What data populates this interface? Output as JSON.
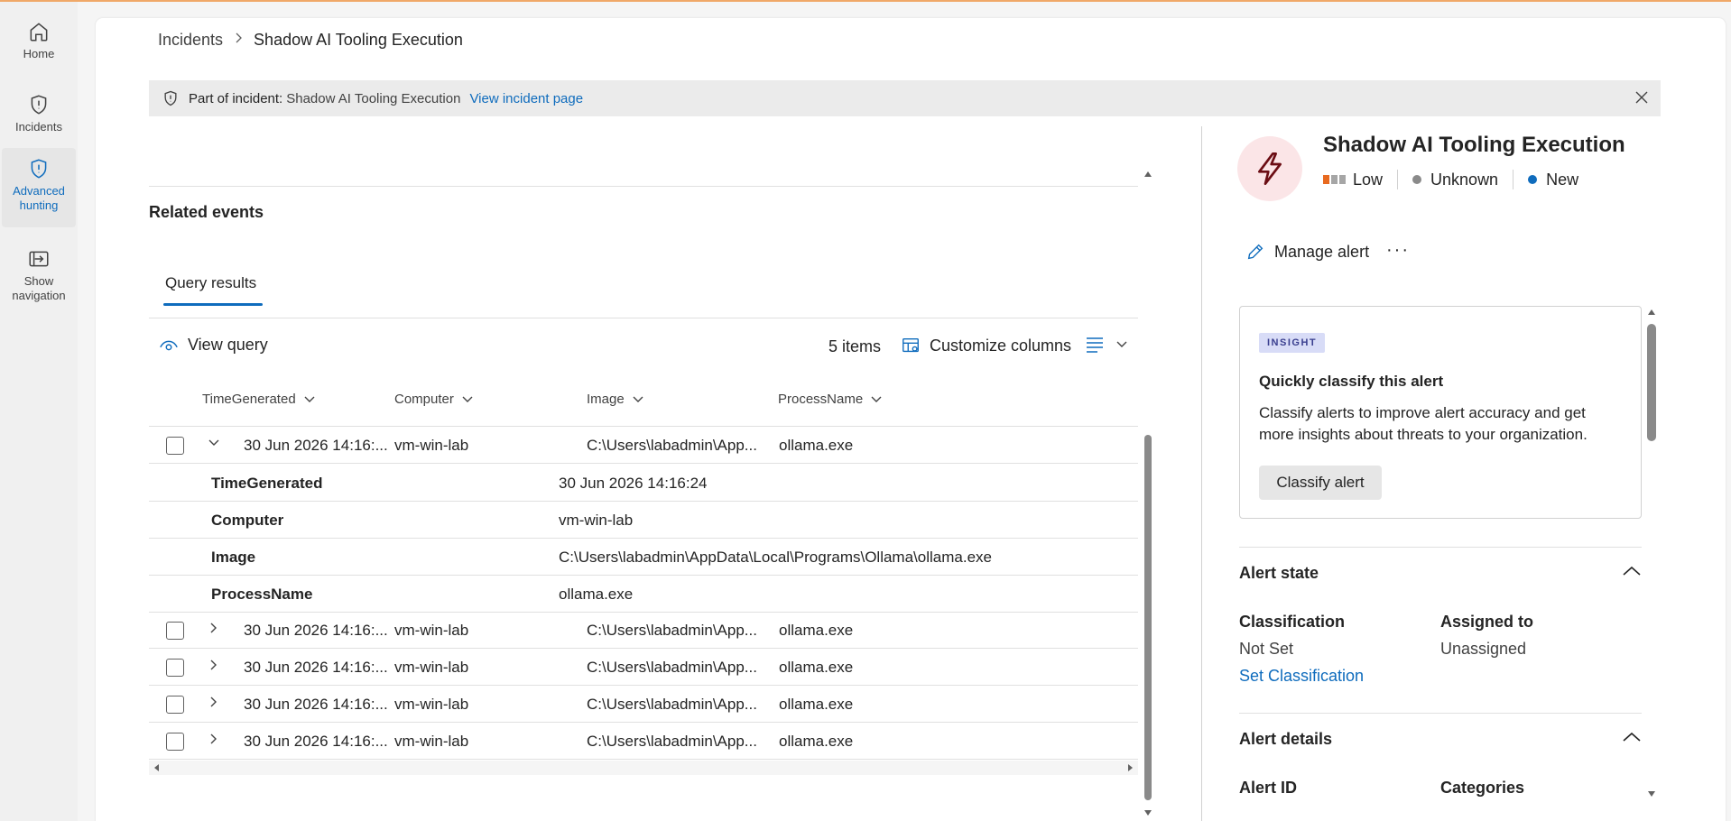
{
  "nav": {
    "home": "Home",
    "incidents": "Incidents",
    "advanced_hunting_1": "Advanced",
    "advanced_hunting_2": "hunting",
    "show_nav_1": "Show",
    "show_nav_2": "navigation"
  },
  "breadcrumb": {
    "root": "Incidents",
    "current": "Shadow AI Tooling Execution"
  },
  "banner": {
    "label": "Part of incident:",
    "value": "Shadow AI Tooling Execution",
    "link": "View incident page"
  },
  "related": {
    "title": "Related events",
    "tab": "Query results",
    "view_query": "View query",
    "items_count": "5 items",
    "customize_columns": "Customize columns"
  },
  "table": {
    "columns": [
      "TimeGenerated",
      "Computer",
      "Image",
      "ProcessName"
    ],
    "rows": [
      {
        "time": "30 Jun 2026 14:16:...",
        "computer": "vm-win-lab",
        "image": "C:\\Users\\labadmin\\App...",
        "process": "ollama.exe"
      },
      {
        "time": "30 Jun 2026 14:16:...",
        "computer": "vm-win-lab",
        "image": "C:\\Users\\labadmin\\App...",
        "process": "ollama.exe"
      },
      {
        "time": "30 Jun 2026 14:16:...",
        "computer": "vm-win-lab",
        "image": "C:\\Users\\labadmin\\App...",
        "process": "ollama.exe"
      },
      {
        "time": "30 Jun 2026 14:16:...",
        "computer": "vm-win-lab",
        "image": "C:\\Users\\labadmin\\App...",
        "process": "ollama.exe"
      },
      {
        "time": "30 Jun 2026 14:16:...",
        "computer": "vm-win-lab",
        "image": "C:\\Users\\labadmin\\App...",
        "process": "ollama.exe"
      }
    ],
    "details": [
      {
        "key": "TimeGenerated",
        "value": "30 Jun 2026 14:16:24"
      },
      {
        "key": "Computer",
        "value": "vm-win-lab"
      },
      {
        "key": "Image",
        "value": "C:\\Users\\labadmin\\AppData\\Local\\Programs\\Ollama\\ollama.exe"
      },
      {
        "key": "ProcessName",
        "value": "ollama.exe"
      }
    ]
  },
  "alert": {
    "title": "Shadow AI Tooling Execution",
    "severity": "Low",
    "determination": "Unknown",
    "status": "New",
    "manage": "Manage alert",
    "more": "···"
  },
  "insight": {
    "badge": "INSIGHT",
    "heading": "Quickly classify this alert",
    "body": "Classify alerts to improve alert accuracy and get more insights about threats to your organization.",
    "button": "Classify alert"
  },
  "alert_state": {
    "title": "Alert state",
    "classification_label": "Classification",
    "classification_value": "Not Set",
    "set_classification": "Set Classification",
    "assigned_label": "Assigned to",
    "assigned_value": "Unassigned"
  },
  "alert_details": {
    "title": "Alert details",
    "alert_id_label": "Alert ID",
    "categories_label": "Categories"
  },
  "colors": {
    "accent": "#0f6cbd",
    "severity_low": "#e86a20",
    "status_new": "#0f6cbd",
    "unknown_dot": "#8a8a8a",
    "alert_icon": "#6b0d14"
  }
}
